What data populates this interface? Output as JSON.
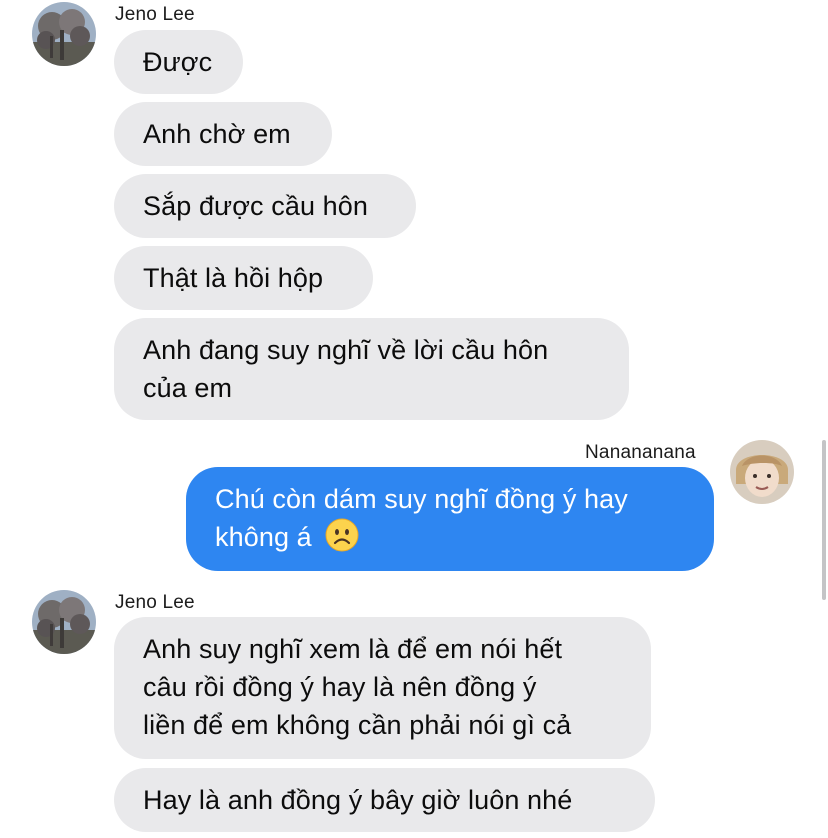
{
  "messages": [
    {
      "sender": "Jeno Lee",
      "direction": "incoming",
      "lines": [
        "Được"
      ]
    },
    {
      "sender": "Jeno Lee",
      "direction": "incoming",
      "lines": [
        "Anh chờ em"
      ]
    },
    {
      "sender": "Jeno Lee",
      "direction": "incoming",
      "lines": [
        "Sắp được cầu hôn"
      ]
    },
    {
      "sender": "Jeno Lee",
      "direction": "incoming",
      "lines": [
        "Thật là hồi hộp"
      ]
    },
    {
      "sender": "Jeno Lee",
      "direction": "incoming",
      "lines": [
        "Anh đang suy nghĩ về lời cầu hôn",
        "của em"
      ]
    },
    {
      "sender": "Nanananana",
      "direction": "outgoing",
      "lines": [
        "Chú còn dám suy nghĩ đồng ý hay",
        "không á"
      ],
      "emoji": "frowning-face"
    },
    {
      "sender": "Jeno Lee",
      "direction": "incoming",
      "lines": [
        "Anh suy nghĩ xem là để em nói hết",
        "câu rồi đồng ý hay là nên đồng ý",
        "liền để em không cần phải nói gì cả"
      ]
    },
    {
      "sender": "Jeno Lee",
      "direction": "incoming",
      "lines": [
        "Hay là anh đồng ý bây giờ luôn nhé"
      ]
    }
  ],
  "colors": {
    "incoming_bubble": "#e9e9eb",
    "outgoing_bubble": "#2e86f1",
    "incoming_text": "#0c0c0c",
    "outgoing_text": "#ffffff"
  }
}
